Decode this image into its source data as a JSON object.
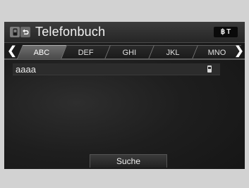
{
  "header": {
    "title": "Telefonbuch",
    "left_icons": [
      "phone-icon",
      "back-icon"
    ],
    "status_icons": [
      "bluetooth-icon",
      "signal-icon"
    ]
  },
  "tabs": [
    {
      "label": "ABC",
      "active": true
    },
    {
      "label": "DEF",
      "active": false
    },
    {
      "label": "GHI",
      "active": false
    },
    {
      "label": "JKL",
      "active": false
    },
    {
      "label": "MNO",
      "active": false
    }
  ],
  "contacts": [
    {
      "name": "aaaa",
      "icon": "phone-device-icon"
    }
  ],
  "footer": {
    "search_label": "Suche"
  }
}
